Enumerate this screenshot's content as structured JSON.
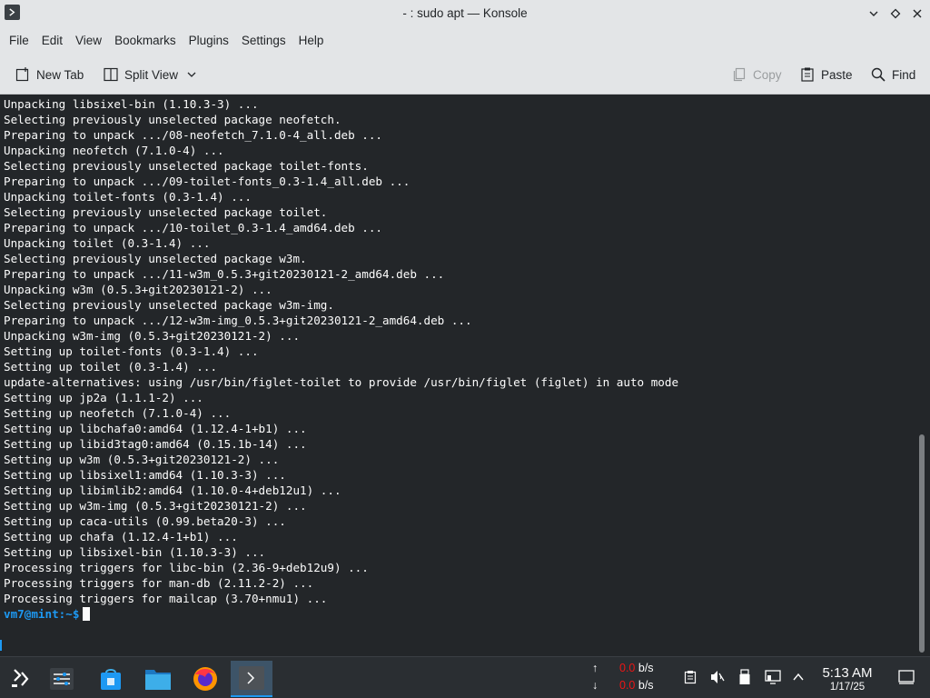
{
  "window": {
    "title": "- : sudo apt — Konsole",
    "app_icon": "konsole-icon",
    "controls": [
      "minimize-icon",
      "maximize-icon",
      "close-icon"
    ]
  },
  "menubar": {
    "items": [
      "File",
      "Edit",
      "View",
      "Bookmarks",
      "Plugins",
      "Settings",
      "Help"
    ]
  },
  "toolbar": {
    "new_tab": "New Tab",
    "split_view": "Split View",
    "copy": "Copy",
    "paste": "Paste",
    "find": "Find"
  },
  "terminal": {
    "lines": [
      "Unpacking libsixel-bin (1.10.3-3) ...",
      "Selecting previously unselected package neofetch.",
      "Preparing to unpack .../08-neofetch_7.1.0-4_all.deb ...",
      "Unpacking neofetch (7.1.0-4) ...",
      "Selecting previously unselected package toilet-fonts.",
      "Preparing to unpack .../09-toilet-fonts_0.3-1.4_all.deb ...",
      "Unpacking toilet-fonts (0.3-1.4) ...",
      "Selecting previously unselected package toilet.",
      "Preparing to unpack .../10-toilet_0.3-1.4_amd64.deb ...",
      "Unpacking toilet (0.3-1.4) ...",
      "Selecting previously unselected package w3m.",
      "Preparing to unpack .../11-w3m_0.5.3+git20230121-2_amd64.deb ...",
      "Unpacking w3m (0.5.3+git20230121-2) ...",
      "Selecting previously unselected package w3m-img.",
      "Preparing to unpack .../12-w3m-img_0.5.3+git20230121-2_amd64.deb ...",
      "Unpacking w3m-img (0.5.3+git20230121-2) ...",
      "Setting up toilet-fonts (0.3-1.4) ...",
      "Setting up toilet (0.3-1.4) ...",
      "update-alternatives: using /usr/bin/figlet-toilet to provide /usr/bin/figlet (figlet) in auto mode",
      "Setting up jp2a (1.1.1-2) ...",
      "Setting up neofetch (7.1.0-4) ...",
      "Setting up libchafa0:amd64 (1.12.4-1+b1) ...",
      "Setting up libid3tag0:amd64 (0.15.1b-14) ...",
      "Setting up w3m (0.5.3+git20230121-2) ...",
      "Setting up libsixel1:amd64 (1.10.3-3) ...",
      "Setting up libimlib2:amd64 (1.10.0-4+deb12u1) ...",
      "Setting up w3m-img (0.5.3+git20230121-2) ...",
      "Setting up caca-utils (0.99.beta20-3) ...",
      "Setting up chafa (1.12.4-1+b1) ...",
      "Setting up libsixel-bin (1.10.3-3) ...",
      "Processing triggers for libc-bin (2.36-9+deb12u9) ...",
      "Processing triggers for man-db (2.11.2-2) ...",
      "Processing triggers for mailcap (3.70+nmu1) ..."
    ],
    "prompt_user": "vm7@mint",
    "prompt_path": ":~$"
  },
  "taskbar": {
    "net_up": "0.0",
    "net_down": "0.0",
    "net_unit": "b/s",
    "net_up_arrow": "↑",
    "net_down_arrow": "↓",
    "time": "5:13 AM",
    "date": "1/17/25"
  },
  "colors": {
    "terminal_bg": "#232629",
    "prompt": "#1d99f3",
    "net_value": "#ed1515"
  }
}
